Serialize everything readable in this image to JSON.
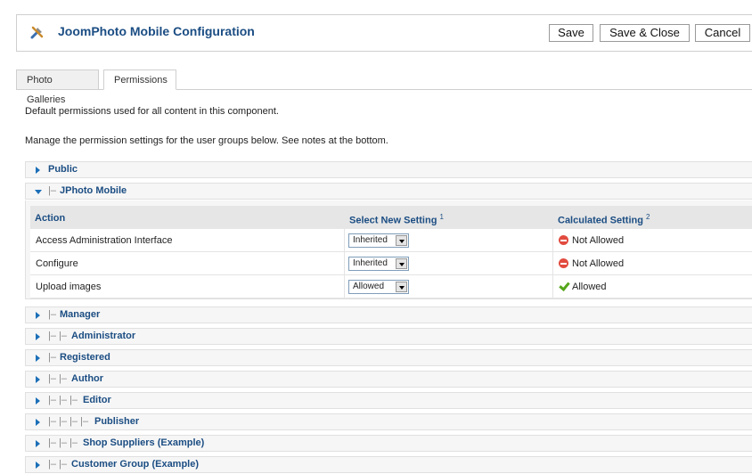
{
  "header": {
    "icon": "tools-icon",
    "title": "JoomPhoto Mobile Configuration",
    "buttons": {
      "save": "Save",
      "save_close": "Save & Close",
      "cancel": "Cancel"
    }
  },
  "tabs": [
    {
      "label": "Photo Galleries"
    },
    {
      "label": "Permissions",
      "active": true
    }
  ],
  "intro": {
    "line1": "Default permissions used for all content in this component.",
    "line2": "Manage the permission settings for the user groups below. See notes at the bottom."
  },
  "groups": [
    {
      "prefix": "",
      "name": "Public"
    },
    {
      "prefix": "|–",
      "name": "JPhoto Mobile",
      "expanded": true
    },
    {
      "prefix": "|–",
      "name": "Manager"
    },
    {
      "prefix": "|– |–",
      "name": "Administrator"
    },
    {
      "prefix": "|–",
      "name": "Registered"
    },
    {
      "prefix": "|– |–",
      "name": "Author"
    },
    {
      "prefix": "|– |– |–",
      "name": "Editor"
    },
    {
      "prefix": "|– |– |– |–",
      "name": "Publisher"
    },
    {
      "prefix": "|– |– |–",
      "name": "Shop Suppliers (Example)"
    },
    {
      "prefix": "|– |–",
      "name": "Customer Group (Example)"
    }
  ],
  "permissions_table": {
    "headers": {
      "action": "Action",
      "select": "Select New Setting",
      "select_note": "1",
      "calculated": "Calculated Setting",
      "calculated_note": "2"
    },
    "rows": [
      {
        "action": "Access Administration Interface",
        "setting": "Inherited",
        "calculated": "Not Allowed",
        "status": "denied"
      },
      {
        "action": "Configure",
        "setting": "Inherited",
        "calculated": "Not Allowed",
        "status": "denied"
      },
      {
        "action": "Upload images",
        "setting": "Allowed",
        "calculated": "Allowed",
        "status": "allowed"
      }
    ]
  },
  "colors": {
    "link": "#1b4d83",
    "arrow": "#1b6fb8",
    "denied": "#e24b3f",
    "allowed": "#55a61b"
  }
}
